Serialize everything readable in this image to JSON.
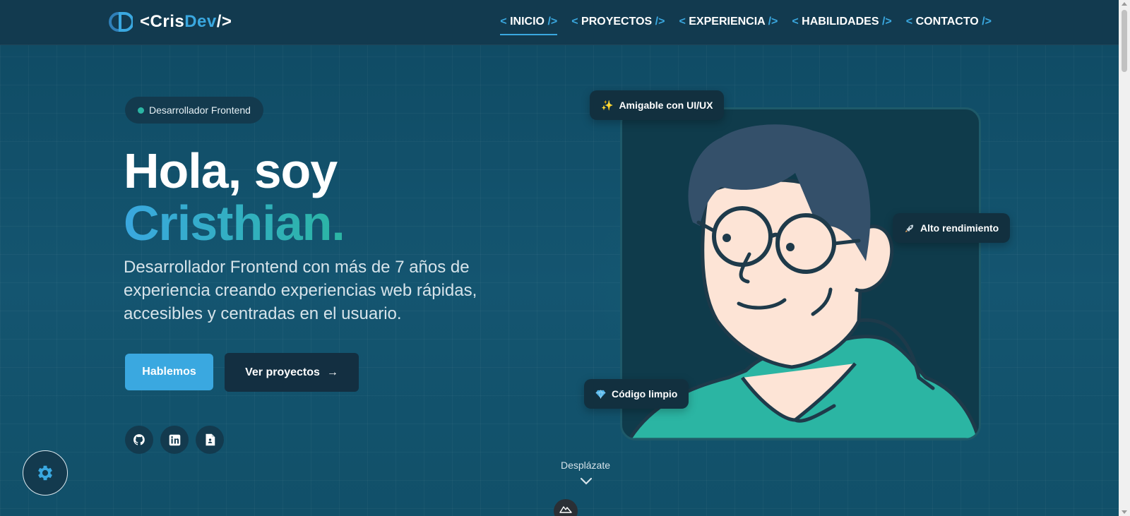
{
  "header": {
    "logo_text_1": "<Cris",
    "logo_text_2": "Dev",
    "logo_text_3": "/>"
  },
  "nav": {
    "items": [
      {
        "label": "INICIO",
        "active": true
      },
      {
        "label": "PROYECTOS",
        "active": false
      },
      {
        "label": "EXPERIENCIA",
        "active": false
      },
      {
        "label": "HABILIDADES",
        "active": false
      },
      {
        "label": "CONTACTO",
        "active": false
      }
    ],
    "open_bracket": "<",
    "close_bracket": "/>"
  },
  "hero": {
    "badge": "Desarrollador Frontend",
    "title_line1": "Hola, soy",
    "title_line2": "Cristhian.",
    "description": "Desarrollador Frontend con más de 7 años de experiencia creando experiencias web rápidas, accesibles y centradas en el usuario.",
    "primary_button": "Hablemos",
    "secondary_button": "Ver proyectos",
    "secondary_arrow": "→"
  },
  "social": [
    {
      "icon": "github-icon"
    },
    {
      "icon": "linkedin-icon"
    },
    {
      "icon": "document-icon"
    }
  ],
  "tags": {
    "uiux": "Amigable con UI/UX",
    "uiux_emoji": "✨",
    "performance": "Alto rendimiento",
    "clean_code": "Código limpio"
  },
  "scroll_hint": "Desplázate",
  "colors": {
    "accent": "#3aa8e0",
    "teal": "#2bb5a3",
    "background": "#135068",
    "header": "#123a4f"
  }
}
